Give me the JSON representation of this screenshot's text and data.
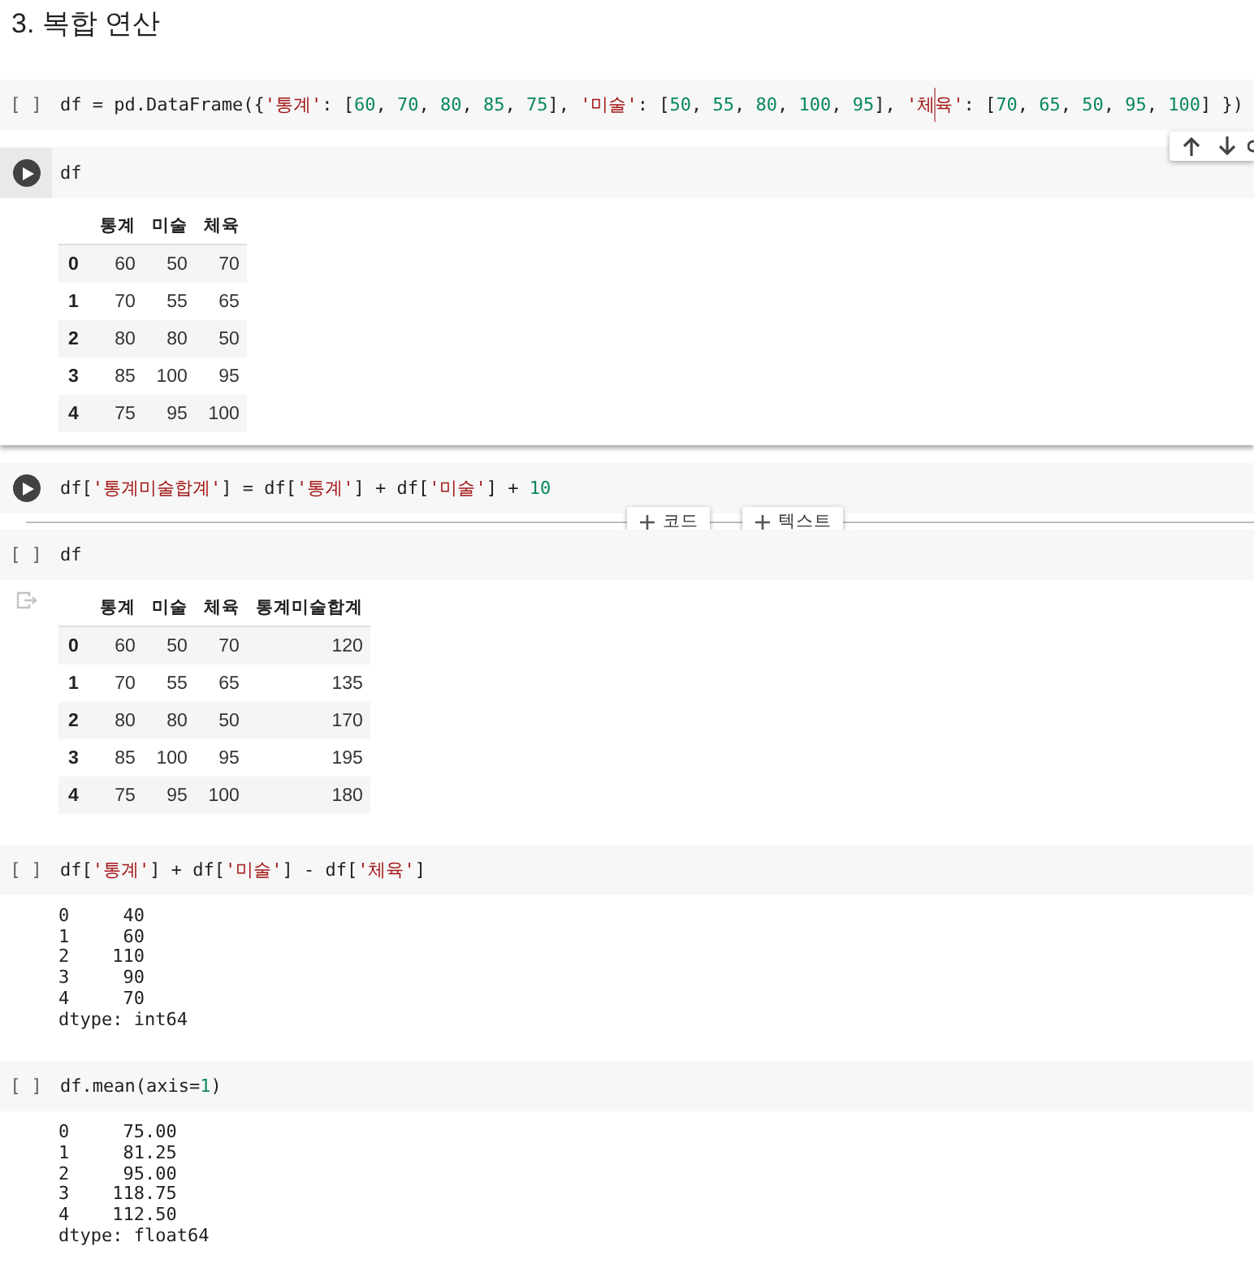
{
  "heading": "3. 복합 연산",
  "cells": [
    {
      "selected": false,
      "gutter": {
        "kind": "prompt",
        "text": "[ ]"
      },
      "code": [
        {
          "kind": "plain",
          "text": "df = pd.DataFrame({"
        },
        {
          "kind": "string",
          "text": "'통계'"
        },
        {
          "kind": "plain",
          "text": ": ["
        },
        {
          "kind": "number",
          "text": "60"
        },
        {
          "kind": "plain",
          "text": ", "
        },
        {
          "kind": "number",
          "text": "70"
        },
        {
          "kind": "plain",
          "text": ", "
        },
        {
          "kind": "number",
          "text": "80"
        },
        {
          "kind": "plain",
          "text": ", "
        },
        {
          "kind": "number",
          "text": "85"
        },
        {
          "kind": "plain",
          "text": ", "
        },
        {
          "kind": "number",
          "text": "75"
        },
        {
          "kind": "plain",
          "text": "], "
        },
        {
          "kind": "string",
          "text": "'미술'"
        },
        {
          "kind": "plain",
          "text": ": ["
        },
        {
          "kind": "number",
          "text": "50"
        },
        {
          "kind": "plain",
          "text": ", "
        },
        {
          "kind": "number",
          "text": "55"
        },
        {
          "kind": "plain",
          "text": ", "
        },
        {
          "kind": "number",
          "text": "80"
        },
        {
          "kind": "plain",
          "text": ", "
        },
        {
          "kind": "number",
          "text": "100"
        },
        {
          "kind": "plain",
          "text": ", "
        },
        {
          "kind": "number",
          "text": "95"
        },
        {
          "kind": "plain",
          "text": "], "
        },
        {
          "kind": "string",
          "text": "'체"
        },
        {
          "kind": "cursor"
        },
        {
          "kind": "string",
          "text": "육'"
        },
        {
          "kind": "plain",
          "text": ": ["
        },
        {
          "kind": "number",
          "text": "70"
        },
        {
          "kind": "plain",
          "text": ", "
        },
        {
          "kind": "number",
          "text": "65"
        },
        {
          "kind": "plain",
          "text": ", "
        },
        {
          "kind": "number",
          "text": "50"
        },
        {
          "kind": "plain",
          "text": ", "
        },
        {
          "kind": "number",
          "text": "95"
        },
        {
          "kind": "plain",
          "text": ", "
        },
        {
          "kind": "number",
          "text": "100"
        },
        {
          "kind": "plain",
          "text": "] })"
        }
      ]
    },
    {
      "selected": true,
      "gutter": {
        "kind": "run-button"
      },
      "code": [
        {
          "kind": "plain",
          "text": "df"
        }
      ],
      "output": {
        "kind": "table",
        "output_icon": false,
        "columns": [
          "통계",
          "미술",
          "체육"
        ],
        "rows": [
          {
            "index": "0",
            "values": [
              "60",
              "50",
              "70"
            ]
          },
          {
            "index": "1",
            "values": [
              "70",
              "55",
              "65"
            ]
          },
          {
            "index": "2",
            "values": [
              "80",
              "80",
              "50"
            ]
          },
          {
            "index": "3",
            "values": [
              "85",
              "100",
              "95"
            ]
          },
          {
            "index": "4",
            "values": [
              "75",
              "95",
              "100"
            ]
          }
        ]
      }
    },
    {
      "selected": false,
      "gutter": {
        "kind": "run-button"
      },
      "code": [
        {
          "kind": "plain",
          "text": "df["
        },
        {
          "kind": "string",
          "text": "'통계미술합계'"
        },
        {
          "kind": "plain",
          "text": "] = df["
        },
        {
          "kind": "string",
          "text": "'통계'"
        },
        {
          "kind": "plain",
          "text": "] + df["
        },
        {
          "kind": "string",
          "text": "'미술'"
        },
        {
          "kind": "plain",
          "text": "] + "
        },
        {
          "kind": "number",
          "text": "10"
        }
      ],
      "add_buttons": [
        "코드",
        "텍스트"
      ]
    },
    {
      "selected": false,
      "gutter": {
        "kind": "prompt",
        "text": "[ ]"
      },
      "code": [
        {
          "kind": "plain",
          "text": "df"
        }
      ],
      "output": {
        "kind": "table",
        "output_icon": true,
        "columns": [
          "통계",
          "미술",
          "체육",
          "통계미술합계"
        ],
        "rows": [
          {
            "index": "0",
            "values": [
              "60",
              "50",
              "70",
              "120"
            ]
          },
          {
            "index": "1",
            "values": [
              "70",
              "55",
              "65",
              "135"
            ]
          },
          {
            "index": "2",
            "values": [
              "80",
              "80",
              "50",
              "170"
            ]
          },
          {
            "index": "3",
            "values": [
              "85",
              "100",
              "95",
              "195"
            ]
          },
          {
            "index": "4",
            "values": [
              "75",
              "95",
              "100",
              "180"
            ]
          }
        ]
      }
    },
    {
      "selected": false,
      "gutter": {
        "kind": "prompt",
        "text": "[ ]"
      },
      "code": [
        {
          "kind": "plain",
          "text": "df["
        },
        {
          "kind": "string",
          "text": "'통계'"
        },
        {
          "kind": "plain",
          "text": "] + df["
        },
        {
          "kind": "string",
          "text": "'미술'"
        },
        {
          "kind": "plain",
          "text": "] - df["
        },
        {
          "kind": "string",
          "text": "'체육'"
        },
        {
          "kind": "plain",
          "text": "]"
        }
      ],
      "output": {
        "kind": "text",
        "output_icon": false,
        "lines": [
          "0     40",
          "1     60",
          "2    110",
          "3     90",
          "4     70",
          "dtype: int64"
        ]
      }
    },
    {
      "selected": false,
      "gutter": {
        "kind": "prompt",
        "text": "[ ]"
      },
      "code": [
        {
          "kind": "plain",
          "text": "df.mean(axis="
        },
        {
          "kind": "number",
          "text": "1"
        },
        {
          "kind": "plain",
          "text": ")"
        }
      ],
      "output": {
        "kind": "text",
        "output_icon": false,
        "lines": [
          "0     75.00",
          "1     81.25",
          "2     95.00",
          "3    118.75",
          "4    112.50",
          "dtype: float64"
        ]
      }
    }
  ]
}
